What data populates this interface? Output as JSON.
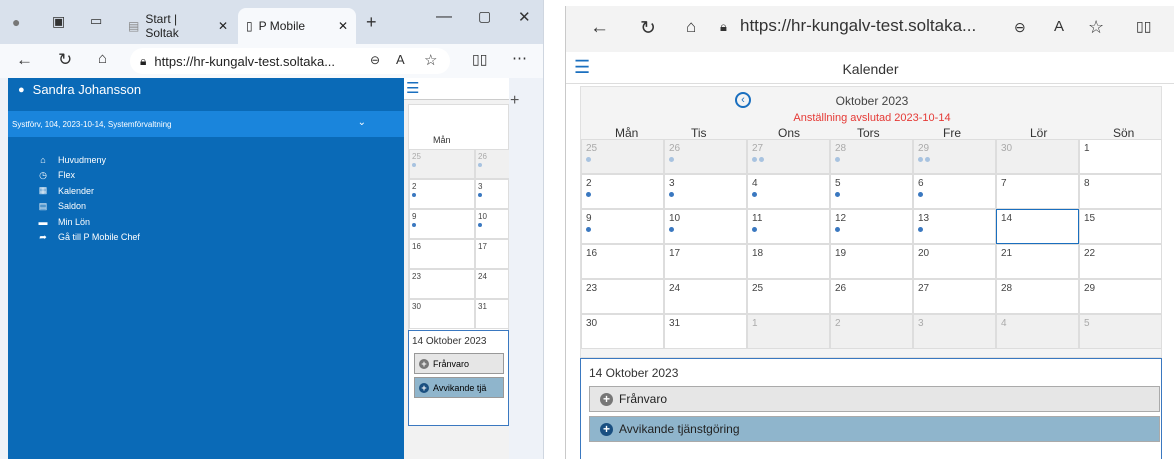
{
  "left_window": {
    "tabs": [
      {
        "label": "Start | Soltak"
      },
      {
        "label": "P Mobile"
      }
    ],
    "url": "https://hr-kungalv-test.soltaka...",
    "user_name": "Sandra Johansson",
    "context": "Systförv, 104, 2023-10-14, Systemförvaltning",
    "nav": [
      {
        "label": "Huvudmeny",
        "icon": "home-icon"
      },
      {
        "label": "Flex",
        "icon": "clock-icon"
      },
      {
        "label": "Kalender",
        "icon": "calendar-icon"
      },
      {
        "label": "Saldon",
        "icon": "document-icon"
      },
      {
        "label": "Min Lön",
        "icon": "card-icon"
      },
      {
        "label": "Gå till P Mobile Chef",
        "icon": "share-arrow-icon"
      }
    ],
    "mini_weekday": "Mån",
    "mini_rows": [
      [
        "25",
        "26"
      ],
      [
        "2",
        "3"
      ],
      [
        "9",
        "10"
      ],
      [
        "16",
        "17"
      ],
      [
        "23",
        "24"
      ],
      [
        "30",
        "31"
      ]
    ],
    "day_header": "14 Oktober 2023",
    "btn_absence": "Frånvaro",
    "btn_deviation": "Avvikande tjä"
  },
  "right_window": {
    "url": "https://hr-kungalv-test.soltaka...",
    "title": "Kalender",
    "month": "Oktober 2023",
    "employment_note": "Anställning avslutad 2023-10-14",
    "weekdays": [
      "Mån",
      "Tis",
      "Ons",
      "Tors",
      "Fre",
      "Lör",
      "Sön"
    ],
    "weeks": [
      [
        {
          "d": "25",
          "g": 1,
          "dots": 1
        },
        {
          "d": "26",
          "g": 1,
          "dots": 1
        },
        {
          "d": "27",
          "g": 1,
          "dots": 2
        },
        {
          "d": "28",
          "g": 1,
          "dots": 1
        },
        {
          "d": "29",
          "g": 1,
          "dots": 2
        },
        {
          "d": "30",
          "g": 1,
          "dots": 0
        },
        {
          "d": "1",
          "g": 0,
          "dots": 0
        }
      ],
      [
        {
          "d": "2",
          "g": 0,
          "dots": 1
        },
        {
          "d": "3",
          "g": 0,
          "dots": 1
        },
        {
          "d": "4",
          "g": 0,
          "dots": 1
        },
        {
          "d": "5",
          "g": 0,
          "dots": 1
        },
        {
          "d": "6",
          "g": 0,
          "dots": 1
        },
        {
          "d": "7",
          "g": 0,
          "dots": 0
        },
        {
          "d": "8",
          "g": 0,
          "dots": 0
        }
      ],
      [
        {
          "d": "9",
          "g": 0,
          "dots": 1
        },
        {
          "d": "10",
          "g": 0,
          "dots": 1
        },
        {
          "d": "11",
          "g": 0,
          "dots": 1
        },
        {
          "d": "12",
          "g": 0,
          "dots": 1
        },
        {
          "d": "13",
          "g": 0,
          "dots": 1
        },
        {
          "d": "14",
          "g": 0,
          "dots": 0,
          "sel": 1
        },
        {
          "d": "15",
          "g": 0,
          "dots": 0
        }
      ],
      [
        {
          "d": "16",
          "g": 0,
          "dots": 0
        },
        {
          "d": "17",
          "g": 0,
          "dots": 0
        },
        {
          "d": "18",
          "g": 0,
          "dots": 0
        },
        {
          "d": "19",
          "g": 0,
          "dots": 0
        },
        {
          "d": "20",
          "g": 0,
          "dots": 0
        },
        {
          "d": "21",
          "g": 0,
          "dots": 0
        },
        {
          "d": "22",
          "g": 0,
          "dots": 0
        }
      ],
      [
        {
          "d": "23",
          "g": 0,
          "dots": 0
        },
        {
          "d": "24",
          "g": 0,
          "dots": 0
        },
        {
          "d": "25",
          "g": 0,
          "dots": 0
        },
        {
          "d": "26",
          "g": 0,
          "dots": 0
        },
        {
          "d": "27",
          "g": 0,
          "dots": 0
        },
        {
          "d": "28",
          "g": 0,
          "dots": 0
        },
        {
          "d": "29",
          "g": 0,
          "dots": 0
        }
      ],
      [
        {
          "d": "30",
          "g": 0,
          "dots": 0
        },
        {
          "d": "31",
          "g": 0,
          "dots": 0
        },
        {
          "d": "1",
          "g": 1,
          "dots": 0
        },
        {
          "d": "2",
          "g": 1,
          "dots": 0
        },
        {
          "d": "3",
          "g": 1,
          "dots": 0
        },
        {
          "d": "4",
          "g": 1,
          "dots": 0
        },
        {
          "d": "5",
          "g": 1,
          "dots": 0
        }
      ]
    ],
    "day_header": "14 Oktober 2023",
    "btn_absence": "Frånvaro",
    "btn_deviation": "Avvikande tjänstgöring"
  },
  "colors": {
    "sidebar": "#0a6ab7",
    "accent": "#1a6fbf",
    "warning_text": "#e53935",
    "deviation_button": "#8fb5cc",
    "absence_button": "#e6e6e6"
  }
}
